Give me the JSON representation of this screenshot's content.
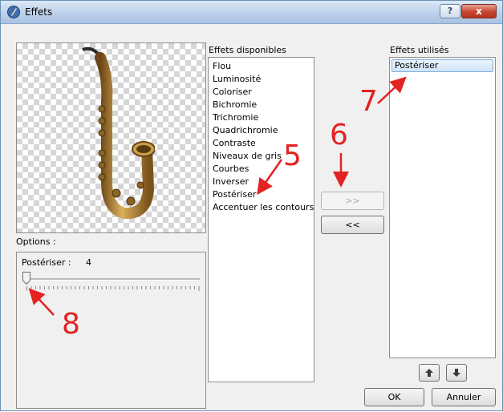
{
  "window": {
    "title": "Effets"
  },
  "titlebar": {
    "help_label": "?",
    "close_label": "x"
  },
  "available": {
    "label": "Effets disponibles",
    "items": [
      "Flou",
      "Luminosité",
      "Coloriser",
      "Bichromie",
      "Trichromie",
      "Quadrichromie",
      "Contraste",
      "Niveaux de gris",
      "Courbes",
      "Inverser",
      "Postériser",
      "Accentuer les contours"
    ]
  },
  "used": {
    "label": "Effets utilisés",
    "items": [
      "Postériser"
    ]
  },
  "buttons": {
    "add": ">>",
    "remove": "<<",
    "ok": "OK",
    "cancel": "Annuler"
  },
  "options": {
    "label": "Options :",
    "param_label": "Postériser :",
    "param_value": "4",
    "slider_fraction": 0.0
  },
  "annotations": [
    "5",
    "6",
    "7",
    "8"
  ],
  "colors": {
    "annotation": "#e32222",
    "selection": "#cfe4f8"
  }
}
